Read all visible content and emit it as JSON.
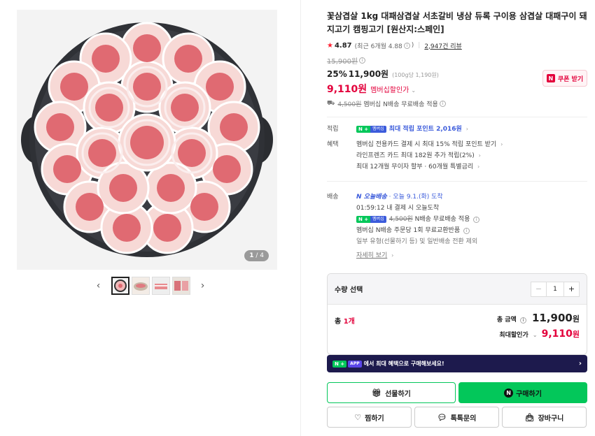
{
  "gallery": {
    "counter_current": "1",
    "counter_total": "/ 4",
    "prev_label": "‹",
    "next_label": "›"
  },
  "product": {
    "title": "꽃삼겹살 1kg 대패삼겹살 서초갈비 냉삼 듀록 구이용 삼겹살 대패구이 돼지고기 캠핑고기 [원산지:스페인]",
    "rating": "4.87",
    "recent_rating": "(최근 6개월 4.88",
    "recent_rating_close": ")",
    "review_count": "2,947건 리뷰",
    "original_price": "15,900원",
    "discount_rate": "25%",
    "sale_price": "11,900원",
    "unit_price": "(100g당 1,190원)",
    "member_price": "9,110원",
    "member_label": "멤버십할인가",
    "coupon_label": "쿠폰 받기",
    "coupon_badge": "N",
    "ship_original": "4,500원",
    "ship_summary": "멤버십 N배송 무료배송 적용"
  },
  "benefits": {
    "points_label": "적립",
    "points_badge_n": "N +",
    "points_badge_member": "멤버십",
    "points_text": "최대 적립 포인트 2,016원",
    "benefit_label": "혜택",
    "benefit_lines": [
      "멤버십 전용카드 결제 시 최대 15% 적립 포인트 받기",
      "라인프렌즈 카드 최대 182원 추가 적립(2%)",
      "최대 12개월 무이자 할부 · 60개월 특별금리"
    ]
  },
  "delivery": {
    "label": "배송",
    "today_badge": "N 오늘배송",
    "today_text": "· 오늘 9.1.(화) 도착",
    "countdown": "01:59:12  내 결제 시 오늘도착",
    "member_badge_n": "N +",
    "member_badge": "멤버십",
    "ship_original": "4,500원",
    "ship_text": "N배송 무료배송 적용",
    "return_text": "멤버십 N배송 주문당 1회 무료교환반품",
    "exclude_text": "일부 유형(선물하기 등) 및 일반배송 전환 제외",
    "more_link": "자세히 보기"
  },
  "quantity": {
    "label": "수량 선택",
    "value": "1",
    "minus": "−",
    "plus": "+",
    "total_prefix": "총 ",
    "total_count": "1개",
    "total_amount_label": "총 금액",
    "total_amount": "11,900",
    "total_amount_won": "원",
    "max_discount_label": "최대할인가",
    "max_discount": "9,110",
    "max_discount_won": "원"
  },
  "app_banner": {
    "n_badge": "N +",
    "app_tag": "APP",
    "text": "에서 최대 혜택으로 구매해보세요!"
  },
  "actions": {
    "gift": "선물하기",
    "buy": "구매하기",
    "wish": "찜하기",
    "talk": "톡톡문의",
    "cart": "장바구니"
  },
  "colors": {
    "brand_green": "#03c75a",
    "accent_red": "#e3003b",
    "blue": "#3b5bdb",
    "banner_navy": "#1d1a4d"
  }
}
